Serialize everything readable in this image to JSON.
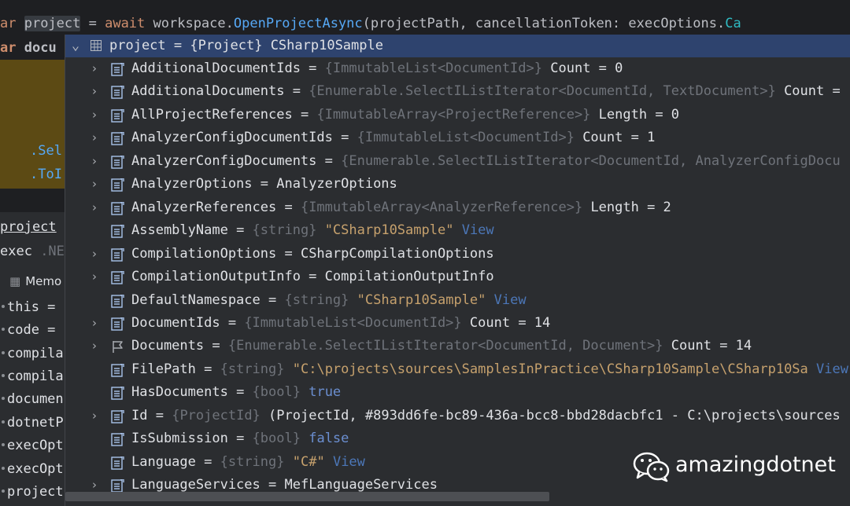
{
  "editor": {
    "line1": {
      "t1": "ar ",
      "t2": "project",
      "t3": " = ",
      "t4": "await",
      "t5": " workspace.",
      "t6": "OpenProjectAsync",
      "t7": "(projectPath, cancellationToken: execOptions.",
      "t8": "Ca"
    },
    "line2": {
      "t1": "ar",
      "t2": "docu"
    },
    "sel_text": ".Sel",
    "toi_text": ".ToI"
  },
  "debug_panel": {
    "project_tab": "project",
    "exec_label": "exec",
    "exec_dim": " .NE",
    "memory_label": "Memo",
    "variables": [
      "this =",
      "code =",
      "compila",
      "compila",
      "documen",
      "dotnetP",
      "execOpt",
      "execOpt",
      "project"
    ]
  },
  "popup": {
    "header": "project = {Project} CSharp10Sample",
    "rows": [
      {
        "name": "AdditionalDocumentIds",
        "type": "{ImmutableList<DocumentId>}",
        "value": "Count = 0",
        "expand": true,
        "icon": "field-icon"
      },
      {
        "name": "AdditionalDocuments",
        "type": "{Enumerable.SelectIListIterator<DocumentId, TextDocument>}",
        "value": "Count =",
        "expand": true,
        "icon": "field-icon"
      },
      {
        "name": "AllProjectReferences",
        "type": "{ImmutableArray<ProjectReference>}",
        "value": "Length = 0",
        "expand": true,
        "icon": "field-icon"
      },
      {
        "name": "AnalyzerConfigDocumentIds",
        "type": "{ImmutableList<DocumentId>}",
        "value": "Count = 1",
        "expand": true,
        "icon": "field-icon"
      },
      {
        "name": "AnalyzerConfigDocuments",
        "type": "{Enumerable.SelectIListIterator<DocumentId, AnalyzerConfigDocu",
        "value": "",
        "expand": true,
        "icon": "field-icon"
      },
      {
        "name": "AnalyzerOptions",
        "type": "",
        "value": "AnalyzerOptions",
        "expand": true,
        "icon": "field-icon"
      },
      {
        "name": "AnalyzerReferences",
        "type": "{ImmutableArray<AnalyzerReference>}",
        "value": "Length = 2",
        "expand": true,
        "icon": "field-icon"
      },
      {
        "name": "AssemblyName",
        "type": "{string}",
        "str": "\"CSharp10Sample\"",
        "link": "View",
        "expand": false,
        "icon": "field-icon"
      },
      {
        "name": "CompilationOptions",
        "type": "",
        "value": "CSharpCompilationOptions",
        "expand": true,
        "icon": "field-icon"
      },
      {
        "name": "CompilationOutputInfo",
        "type": "",
        "value": "CompilationOutputInfo",
        "expand": true,
        "icon": "field-icon"
      },
      {
        "name": "DefaultNamespace",
        "type": "{string}",
        "str": "\"CSharp10Sample\"",
        "link": "View",
        "expand": false,
        "icon": "field-icon"
      },
      {
        "name": "DocumentIds",
        "type": "{ImmutableList<DocumentId>}",
        "value": "Count = 14",
        "expand": true,
        "icon": "field-icon"
      },
      {
        "name": "Documents",
        "type": "{Enumerable.SelectIListIterator<DocumentId, Document>}",
        "value": "Count = 14",
        "expand": true,
        "icon": "flag-icon"
      },
      {
        "name": "FilePath",
        "type": "{string}",
        "str": "\"C:\\projects\\sources\\SamplesInPractice\\CSharp10Sample\\CSharp10Sa",
        "link": "View",
        "expand": false,
        "icon": "field-icon"
      },
      {
        "name": "HasDocuments",
        "type": "{bool}",
        "bool": "true",
        "expand": false,
        "icon": "field-icon"
      },
      {
        "name": "Id",
        "type": "{ProjectId}",
        "value": "(ProjectId, #893dd6fe-bc89-436a-bcc8-bbd28dacbfc1 - C:\\projects\\sources",
        "expand": true,
        "icon": "field-icon"
      },
      {
        "name": "IsSubmission",
        "type": "{bool}",
        "bool": "false",
        "expand": false,
        "icon": "field-icon"
      },
      {
        "name": "Language",
        "type": "{string}",
        "str": "\"C#\"",
        "link": "View",
        "expand": false,
        "icon": "field-icon"
      },
      {
        "name": "LanguageServices",
        "type": "",
        "value": "MefLanguageServices",
        "expand": true,
        "icon": "field-icon"
      }
    ]
  },
  "watermark": {
    "text": "amazingdotnet"
  },
  "colors": {
    "header_bg": "#2e436e",
    "popup_bg": "#2b2d30",
    "exec_highlight": "#5c4a14",
    "string": "#c6a16d",
    "link": "#4c77b8"
  }
}
